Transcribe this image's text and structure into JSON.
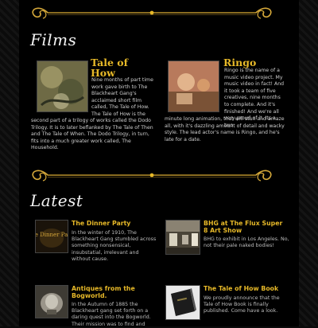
{
  "films": {
    "heading": "Films",
    "items": [
      {
        "title_line1": "Tale of",
        "title_line2": "How",
        "text_right": "Nine months of part time work gave birth to The Blackheart Gang's acclaimed short film called, The Tale of How. The Tale of How is the",
        "text_wide": "second part of a trilogy of works called the Dodo Trilogy. It is to later beflanked by The Tale of Then and The Tale of When. The Dodo Trilogy, in turn, fits into a much greater work called, The Household."
      },
      {
        "title_line1": "Ringo",
        "text_right": "Ringo is the name of a music video project. My music video in fact! And it took a team of five creatives, nine months to complete. And it's finished! And we're all very proud of it. Its a two",
        "text_wide": "minute long animation, that will stun and amaze all, with it's dazzling amount of detail and wacky style. The lead actor's name is Ringo, and he's late for a date."
      }
    ]
  },
  "latest": {
    "heading": "Latest",
    "items": [
      {
        "title": "The Dinner Party",
        "text": "In the winter of 1910, The Blackheart Gang stumbled across something nonsensical, insubstatial, irrelevant and without cause.",
        "thumb_caption": "The Dinner Party"
      },
      {
        "title": "BHG at The Flux Super 8 Art Show",
        "text": "BHG to exhibit in Los Angeles. No, not their pale naked bodies!"
      },
      {
        "title": "Antiques from the Bogworld.",
        "text": "In the Autumn of 1885 the Blackheart gang set forth on a daring quest into the Bogworld. Their mission was to find and"
      },
      {
        "title": "The Tale of How Book",
        "text": "We proudly announce that the Tale of How Book is finally published. Come have a look."
      }
    ]
  },
  "colors": {
    "accent_gold": "#e6b828",
    "background": "#000000"
  }
}
